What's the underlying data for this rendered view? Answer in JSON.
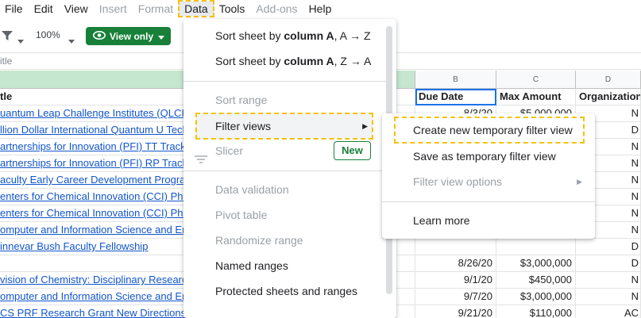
{
  "menubar": {
    "items": [
      {
        "label": "File",
        "disabled": false
      },
      {
        "label": "Edit",
        "disabled": false
      },
      {
        "label": "View",
        "disabled": false
      },
      {
        "label": "Insert",
        "disabled": true
      },
      {
        "label": "Format",
        "disabled": true
      },
      {
        "label": "Data",
        "disabled": false
      },
      {
        "label": "Tools",
        "disabled": false
      },
      {
        "label": "Add-ons",
        "disabled": true
      },
      {
        "label": "Help",
        "disabled": false
      }
    ]
  },
  "toolbar": {
    "zoom": "100%",
    "view_only_label": "View only"
  },
  "formula_bar": {
    "text": "itle"
  },
  "columns": {
    "b": "B",
    "c": "C",
    "d": "D"
  },
  "header_row": {
    "a": "tle",
    "b": "Due Date",
    "c": "Max Amount",
    "d": "Organization"
  },
  "rows": [
    {
      "a": "uantum Leap Challenge Institutes (QLCI)",
      "b": "8/3/20",
      "c": "$5,000,000",
      "d": "N"
    },
    {
      "a": "llion Dollar International Quantum U Tech",
      "b": "",
      "c": "",
      "d": "D"
    },
    {
      "a": "artnerships for Innovation (PFI) TT Track",
      "b": "",
      "c": "",
      "d": "N"
    },
    {
      "a": "artnerships for Innovation (PFI) RP Track",
      "b": "",
      "c": "",
      "d": "N"
    },
    {
      "a": "aculty Early Career Development Program",
      "b": "",
      "c": "",
      "d": "N"
    },
    {
      "a": "enters for Chemical Innovation  (CCI) Pha",
      "b": "",
      "c": "",
      "d": "N"
    },
    {
      "a": "enters for Chemical Innovation  (CCI) Pha",
      "b": "",
      "c": "",
      "d": "N"
    },
    {
      "a": "omputer and Information Science and En",
      "b": "",
      "c": "",
      "d": "N"
    },
    {
      "a": "innevar Bush Faculty Fellowship",
      "b": "",
      "c": "",
      "d": "D"
    },
    {
      "a": "",
      "b": "8/26/20",
      "c": "$3,000,000",
      "d": "D"
    },
    {
      "a": "vision of Chemistry: Disciplinary Researc",
      "b": "9/1/20",
      "c": "$450,000",
      "d": "N"
    },
    {
      "a": "omputer and Information Science and En",
      "b": "9/7/20",
      "c": "$3,000,000",
      "d": "N"
    },
    {
      "a": "CS PRF Research Grant New Directions",
      "b": "9/21/20",
      "c": "$110,000",
      "d": "AC"
    }
  ],
  "data_menu": {
    "sort_az_prefix": "Sort sheet by ",
    "sort_az_bold": "column A",
    "sort_az_suffix": ", A → Z",
    "sort_za_prefix": "Sort sheet by ",
    "sort_za_bold": "column A",
    "sort_za_suffix": ", Z → A",
    "sort_range": "Sort range",
    "filter_views": "Filter views",
    "slicer": "Slicer",
    "new_badge": "New",
    "data_validation": "Data validation",
    "pivot_table": "Pivot table",
    "randomize_range": "Randomize range",
    "named_ranges": "Named ranges",
    "protected": "Protected sheets and ranges"
  },
  "filter_submenu": {
    "create_temp": "Create new temporary filter view",
    "save_temp": "Save as temporary filter view",
    "options": "Filter view options",
    "learn_more": "Learn more"
  },
  "colors": {
    "accent_green": "#188038",
    "highlight": "#f4c20d",
    "link": "#1155cc"
  }
}
